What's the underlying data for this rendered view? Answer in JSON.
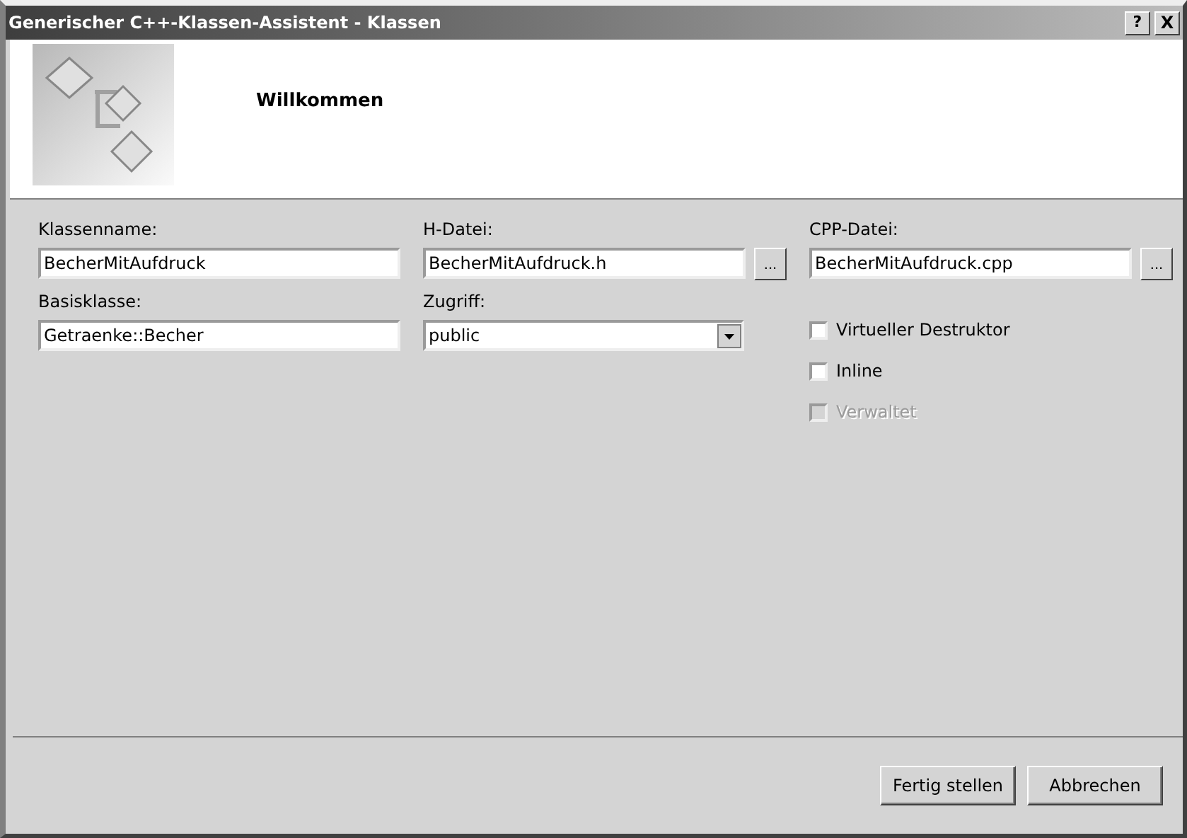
{
  "window": {
    "title": "Generischer C++-Klassen-Assistent - Klassen",
    "title_buttons": [
      {
        "kind": "help",
        "label": "?"
      },
      {
        "kind": "close",
        "label": "X"
      }
    ]
  },
  "header": {
    "title": "Willkommen"
  },
  "fields": [
    {
      "label": "Klassenname:",
      "value": "BecherMitAufdruck",
      "kind": "text"
    },
    {
      "label": "H-Datei:",
      "value": "BecherMitAufdruck.h",
      "kind": "browse",
      "browse_label": "..."
    },
    {
      "label": "CPP-Datei:",
      "value": "BecherMitAufdruck.cpp",
      "kind": "browse",
      "browse_label": "..."
    },
    {
      "label": "Basisklasse:",
      "value": "Getraenke::Becher",
      "kind": "text"
    },
    {
      "label": "Zugriff:",
      "value": "public",
      "kind": "dropdown"
    }
  ],
  "options": [
    {
      "label": "Virtueller Destruktor",
      "checked": false,
      "disabled": false
    },
    {
      "label": "Inline",
      "checked": false,
      "disabled": false
    },
    {
      "label": "Verwaltet",
      "checked": false,
      "disabled": true
    }
  ],
  "buttons": [
    "Fertig stellen",
    "Abbrechen"
  ]
}
